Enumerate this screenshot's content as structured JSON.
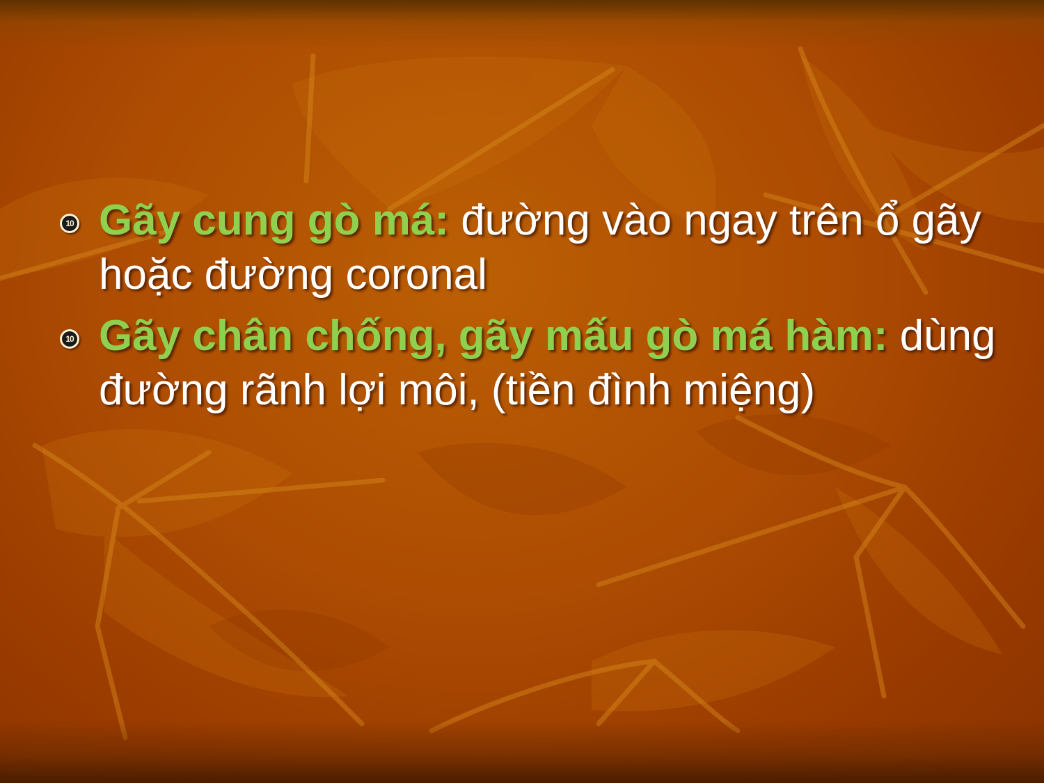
{
  "slide": {
    "colors": {
      "background": "#ad4c02",
      "term": "#8fd14f",
      "body_text": "#ffffff",
      "bullet": "#fbf3d5"
    },
    "bullet_glyph": "10",
    "bullets": [
      {
        "term": "Gãy cung gò má:",
        "text": " đường vào ngay trên ổ gãy hoặc đường coronal"
      },
      {
        "term": "Gãy chân chống, gãy mấu gò má hàm:",
        "text": " dùng đường rãnh lợi môi, (tiền đình miệng)"
      }
    ]
  }
}
